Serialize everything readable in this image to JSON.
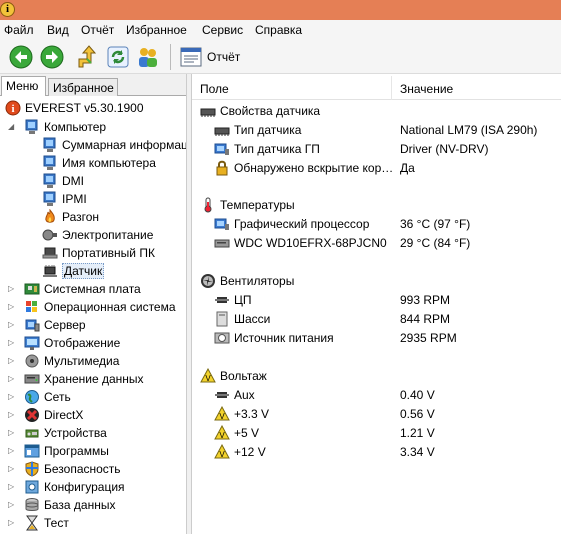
{
  "menubar": {
    "items": [
      "Файл",
      "Вид",
      "Отчёт",
      "Избранное",
      "Сервис",
      "Справка"
    ]
  },
  "toolbar": {
    "report_label": "Отчёт"
  },
  "tabs": {
    "menu": "Меню",
    "favorites": "Избранное"
  },
  "tree": {
    "root": "EVEREST v5.30.1900",
    "computer": "Компьютер",
    "computer_children": [
      "Суммарная информация",
      "Имя компьютера",
      "DMI",
      "IPMI",
      "Разгон",
      "Электропитание",
      "Портативный ПК",
      "Датчик"
    ],
    "categories": [
      "Системная плата",
      "Операционная система",
      "Сервер",
      "Отображение",
      "Мультимедиа",
      "Хранение данных",
      "Сеть",
      "DirectX",
      "Устройства",
      "Программы",
      "Безопасность",
      "Конфигурация",
      "База данных",
      "Тест"
    ]
  },
  "columns": {
    "field": "Поле",
    "value": "Значение"
  },
  "sections": {
    "props": {
      "title": "Свойства датчика",
      "rows": [
        {
          "field": "Тип датчика",
          "value": "National LM79  (ISA 290h)"
        },
        {
          "field": "Тип датчика ГП",
          "value": "Driver  (NV-DRV)"
        },
        {
          "field": "Обнаружено вскрытие корпуса",
          "value": "Да"
        }
      ]
    },
    "temps": {
      "title": "Температуры",
      "rows": [
        {
          "field": "Графический процессор",
          "value": "36 °C  (97 °F)"
        },
        {
          "field": "WDC WD10EFRX-68PJCN0",
          "value": "29 °C  (84 °F)"
        }
      ]
    },
    "fans": {
      "title": "Вентиляторы",
      "rows": [
        {
          "field": "ЦП",
          "value": "993 RPM"
        },
        {
          "field": "Шасси",
          "value": "844 RPM"
        },
        {
          "field": "Источник питания",
          "value": "2935 RPM"
        }
      ]
    },
    "volts": {
      "title": "Вольтаж",
      "rows": [
        {
          "field": "Aux",
          "value": "0.40 V"
        },
        {
          "field": "+3.3 V",
          "value": "0.56 V"
        },
        {
          "field": "+5 V",
          "value": "1.21 V"
        },
        {
          "field": "+12 V",
          "value": "3.34 V"
        }
      ]
    }
  },
  "colors": {
    "titlebar": "#e57f55",
    "selection": "#e5eef9"
  }
}
